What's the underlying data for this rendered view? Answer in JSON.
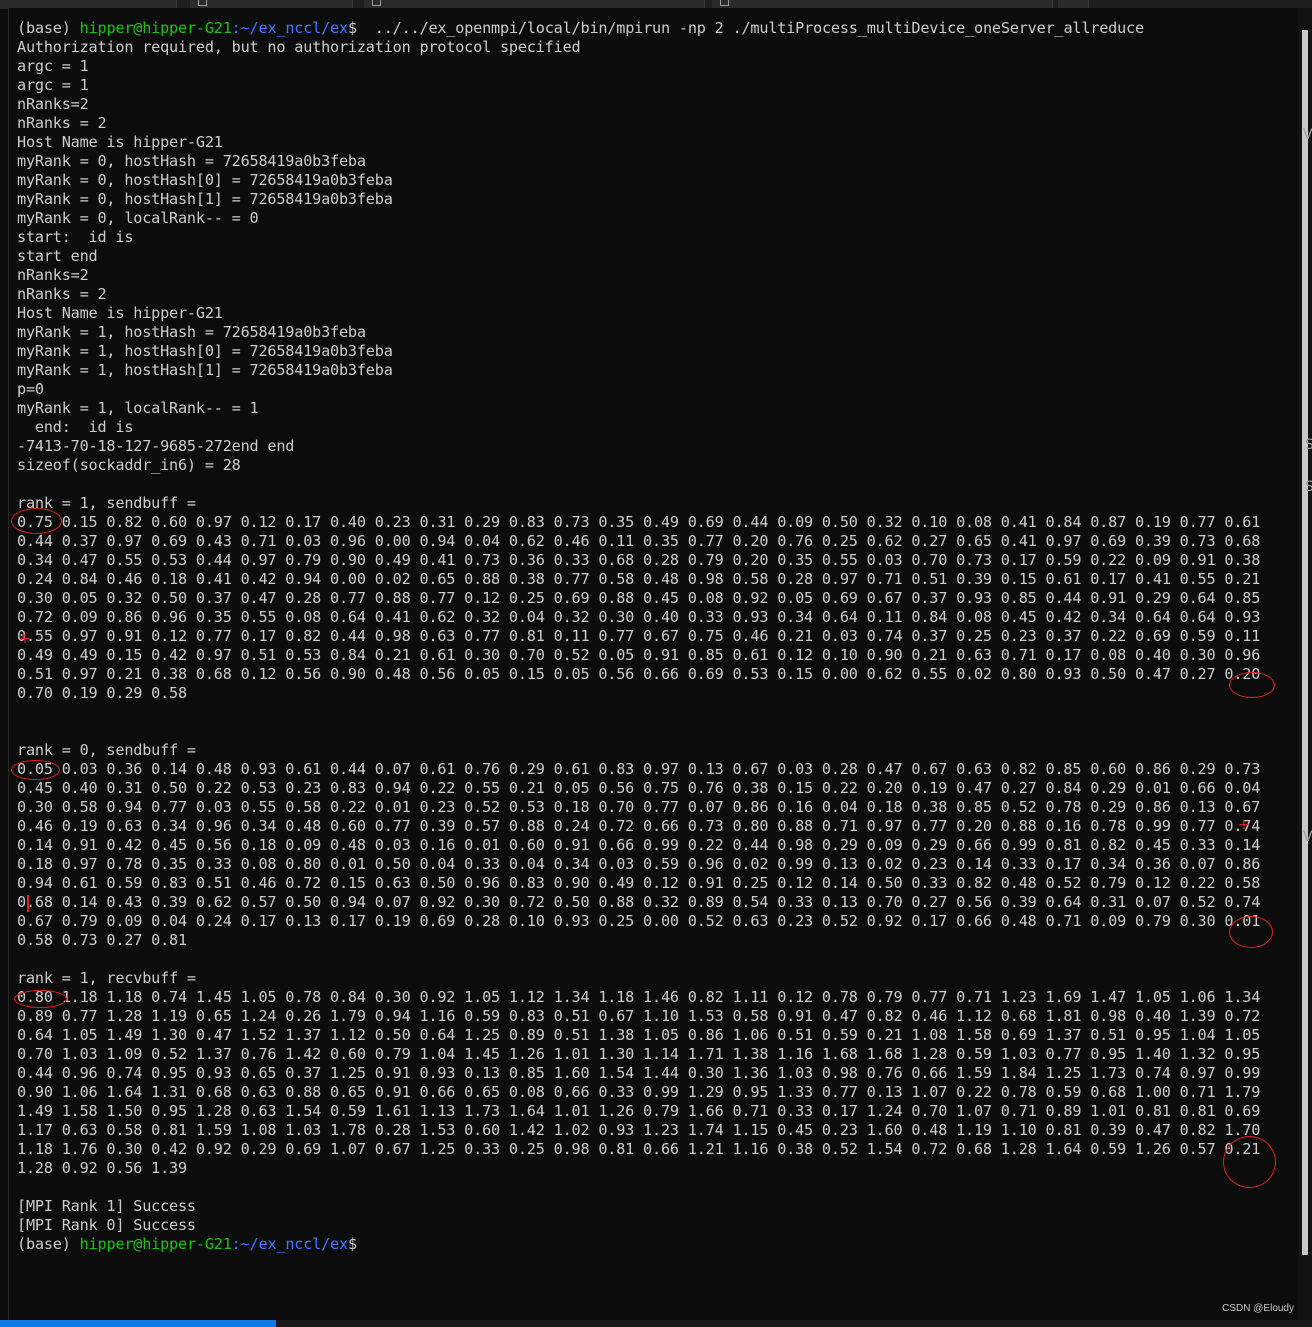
{
  "prompt": {
    "env": "(base)",
    "user_host": "hipper@hipper-G21",
    "path": ":~/ex_nccl/ex",
    "dollar": "$"
  },
  "command": "  ../../ex_openmpi/local/bin/mpirun -np 2 ./multiProcess_multiDevice_oneServer_allreduce",
  "output_lines": [
    "Authorization required, but no authorization protocol specified",
    "argc = 1",
    "argc = 1",
    "nRanks=2",
    "nRanks = 2",
    "Host Name is hipper-G21",
    "myRank = 0, hostHash = 72658419a0b3feba",
    "myRank = 0, hostHash[0] = 72658419a0b3feba",
    "myRank = 0, hostHash[1] = 72658419a0b3feba",
    "myRank = 0, localRank-- = 0",
    "start:  id is",
    "start end",
    "nRanks=2",
    "nRanks = 2",
    "Host Name is hipper-G21",
    "myRank = 1, hostHash = 72658419a0b3feba",
    "myRank = 1, hostHash[0] = 72658419a0b3feba",
    "myRank = 1, hostHash[1] = 72658419a0b3feba",
    "p=0",
    "myRank = 1, localRank-- = 1",
    "  end:  id is",
    "-7413-70-18-127-9685-272end end",
    "sizeof(sockaddr_in6) = 28",
    "",
    "rank = 1, sendbuff =",
    "0.75 0.15 0.82 0.60 0.97 0.12 0.17 0.40 0.23 0.31 0.29 0.83 0.73 0.35 0.49 0.69 0.44 0.09 0.50 0.32 0.10 0.08 0.41 0.84 0.87 0.19 0.77 0.61",
    "0.44 0.37 0.97 0.69 0.43 0.71 0.03 0.96 0.00 0.94 0.04 0.62 0.46 0.11 0.35 0.77 0.20 0.76 0.25 0.62 0.27 0.65 0.41 0.97 0.69 0.39 0.73 0.68",
    "0.34 0.47 0.55 0.53 0.44 0.97 0.79 0.90 0.49 0.41 0.73 0.36 0.33 0.68 0.28 0.79 0.20 0.35 0.55 0.03 0.70 0.73 0.17 0.59 0.22 0.09 0.91 0.38",
    "0.24 0.84 0.46 0.18 0.41 0.42 0.94 0.00 0.02 0.65 0.88 0.38 0.77 0.58 0.48 0.98 0.58 0.28 0.97 0.71 0.51 0.39 0.15 0.61 0.17 0.41 0.55 0.21",
    "0.30 0.05 0.32 0.50 0.37 0.47 0.28 0.77 0.88 0.77 0.12 0.25 0.69 0.88 0.45 0.08 0.92 0.05 0.69 0.67 0.37 0.93 0.85 0.44 0.91 0.29 0.64 0.85",
    "0.72 0.09 0.86 0.96 0.35 0.55 0.08 0.64 0.41 0.62 0.32 0.04 0.32 0.30 0.40 0.33 0.93 0.34 0.64 0.11 0.84 0.08 0.45 0.42 0.34 0.64 0.64 0.93",
    "0.55 0.97 0.91 0.12 0.77 0.17 0.82 0.44 0.98 0.63 0.77 0.81 0.11 0.77 0.67 0.75 0.46 0.21 0.03 0.74 0.37 0.25 0.23 0.37 0.22 0.69 0.59 0.11",
    "0.49 0.49 0.15 0.42 0.97 0.51 0.53 0.84 0.21 0.61 0.30 0.70 0.52 0.05 0.91 0.85 0.61 0.12 0.10 0.90 0.21 0.63 0.71 0.17 0.08 0.40 0.30 0.96",
    "0.51 0.97 0.21 0.38 0.68 0.12 0.56 0.90 0.48 0.56 0.05 0.15 0.05 0.56 0.66 0.69 0.53 0.15 0.00 0.62 0.55 0.02 0.80 0.93 0.50 0.47 0.27 0.20",
    "0.70 0.19 0.29 0.58",
    "",
    "",
    "rank = 0, sendbuff =",
    "0.05 0.03 0.36 0.14 0.48 0.93 0.61 0.44 0.07 0.61 0.76 0.29 0.61 0.83 0.97 0.13 0.67 0.03 0.28 0.47 0.67 0.63 0.82 0.85 0.60 0.86 0.29 0.73",
    "0.45 0.40 0.31 0.50 0.22 0.53 0.23 0.83 0.94 0.22 0.55 0.21 0.05 0.56 0.75 0.76 0.38 0.15 0.22 0.20 0.19 0.47 0.27 0.84 0.29 0.01 0.66 0.04",
    "0.30 0.58 0.94 0.77 0.03 0.55 0.58 0.22 0.01 0.23 0.52 0.53 0.18 0.70 0.77 0.07 0.86 0.16 0.04 0.18 0.38 0.85 0.52 0.78 0.29 0.86 0.13 0.67",
    "0.46 0.19 0.63 0.34 0.96 0.34 0.48 0.60 0.77 0.39 0.57 0.88 0.24 0.72 0.66 0.73 0.80 0.88 0.71 0.97 0.77 0.20 0.88 0.16 0.78 0.99 0.77 0.74",
    "0.14 0.91 0.42 0.45 0.56 0.18 0.09 0.48 0.03 0.16 0.01 0.60 0.91 0.66 0.99 0.22 0.44 0.98 0.29 0.09 0.29 0.66 0.99 0.81 0.82 0.45 0.33 0.14",
    "0.18 0.97 0.78 0.35 0.33 0.08 0.80 0.01 0.50 0.04 0.33 0.04 0.34 0.03 0.59 0.96 0.02 0.99 0.13 0.02 0.23 0.14 0.33 0.17 0.34 0.36 0.07 0.86",
    "0.94 0.61 0.59 0.83 0.51 0.46 0.72 0.15 0.63 0.50 0.96 0.83 0.90 0.49 0.12 0.91 0.25 0.12 0.14 0.50 0.33 0.82 0.48 0.52 0.79 0.12 0.22 0.58",
    "0.68 0.14 0.43 0.39 0.62 0.57 0.50 0.94 0.07 0.92 0.30 0.72 0.50 0.88 0.32 0.89 0.54 0.33 0.13 0.70 0.27 0.56 0.39 0.64 0.31 0.07 0.52 0.74",
    "0.67 0.79 0.09 0.04 0.24 0.17 0.13 0.17 0.19 0.69 0.28 0.10 0.93 0.25 0.00 0.52 0.63 0.23 0.52 0.92 0.17 0.66 0.48 0.71 0.09 0.79 0.30 0.01",
    "0.58 0.73 0.27 0.81",
    "",
    "rank = 1, recvbuff =",
    "0.80 1.18 1.18 0.74 1.45 1.05 0.78 0.84 0.30 0.92 1.05 1.12 1.34 1.18 1.46 0.82 1.11 0.12 0.78 0.79 0.77 0.71 1.23 1.69 1.47 1.05 1.06 1.34",
    "0.89 0.77 1.28 1.19 0.65 1.24 0.26 1.79 0.94 1.16 0.59 0.83 0.51 0.67 1.10 1.53 0.58 0.91 0.47 0.82 0.46 1.12 0.68 1.81 0.98 0.40 1.39 0.72",
    "0.64 1.05 1.49 1.30 0.47 1.52 1.37 1.12 0.50 0.64 1.25 0.89 0.51 1.38 1.05 0.86 1.06 0.51 0.59 0.21 1.08 1.58 0.69 1.37 0.51 0.95 1.04 1.05",
    "0.70 1.03 1.09 0.52 1.37 0.76 1.42 0.60 0.79 1.04 1.45 1.26 1.01 1.30 1.14 1.71 1.38 1.16 1.68 1.68 1.28 0.59 1.03 0.77 0.95 1.40 1.32 0.95",
    "0.44 0.96 0.74 0.95 0.93 0.65 0.37 1.25 0.91 0.93 0.13 0.85 1.60 1.54 1.44 0.30 1.36 1.03 0.98 0.76 0.66 1.59 1.84 1.25 1.73 0.74 0.97 0.99",
    "0.90 1.06 1.64 1.31 0.68 0.63 0.88 0.65 0.91 0.66 0.65 0.08 0.66 0.33 0.99 1.29 0.95 1.33 0.77 0.13 1.07 0.22 0.78 0.59 0.68 1.00 0.71 1.79",
    "1.49 1.58 1.50 0.95 1.28 0.63 1.54 0.59 1.61 1.13 1.73 1.64 1.01 1.26 0.79 1.66 0.71 0.33 0.17 1.24 0.70 1.07 0.71 0.89 1.01 0.81 0.81 0.69",
    "1.17 0.63 0.58 0.81 1.59 1.08 1.03 1.78 0.28 1.53 0.60 1.42 1.02 0.93 1.23 1.74 1.15 0.45 0.23 1.60 0.48 1.19 1.10 0.81 0.39 0.47 0.82 1.70",
    "1.18 1.76 0.30 0.42 0.92 0.29 0.69 1.07 0.67 1.25 0.33 0.25 0.98 0.81 0.66 1.21 1.16 0.38 0.52 1.54 0.72 0.68 1.28 1.64 0.59 1.26 0.57 0.21",
    "1.28 0.92 0.56 1.39",
    "",
    "[MPI Rank 1] Success",
    "[MPI Rank 0] Success"
  ],
  "watermark": "CSDN @Eloudy",
  "colors": {
    "background": "#0c0c0c",
    "text": "#cccccc",
    "prompt_user": "#16c60c",
    "prompt_path": "#3b78ff",
    "annotation": "#e0221d"
  }
}
